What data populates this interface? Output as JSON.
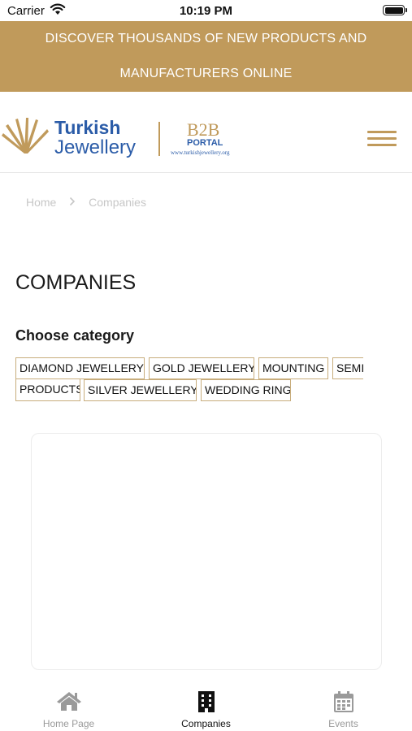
{
  "status_bar": {
    "carrier": "Carrier",
    "time": "10:19 PM"
  },
  "promo": {
    "line1": "DISCOVER THOUSANDS OF NEW PRODUCTS AND",
    "line2": "MANUFACTURERS ONLINE"
  },
  "header": {
    "brand_line1": "Turkish",
    "brand_line2": "Jewellery",
    "b2b": "B2B",
    "portal": "PORTAL",
    "url": "www.turkishjewellery.org",
    "menu_icon": "hamburger-menu-icon"
  },
  "breadcrumb": {
    "home": "Home",
    "current": "Companies"
  },
  "page_title": "COMPANIES",
  "categories": {
    "title": "Choose category",
    "items": [
      "DIAMOND JEWELLERY",
      "GOLD JEWELLERY",
      "MOUNTING",
      "SEMI",
      "PRODUCTS",
      "SILVER JEWELLERY",
      "WEDDING RING"
    ]
  },
  "tabs": [
    {
      "label": "Home Page",
      "icon": "home-icon",
      "active": false
    },
    {
      "label": "Companies",
      "icon": "building-icon",
      "active": true
    },
    {
      "label": "Events",
      "icon": "calendar-icon",
      "active": false
    }
  ],
  "colors": {
    "brand_gold": "#c09a5b",
    "brand_blue": "#2b5ca8",
    "chip_border": "#c8ad7c"
  }
}
